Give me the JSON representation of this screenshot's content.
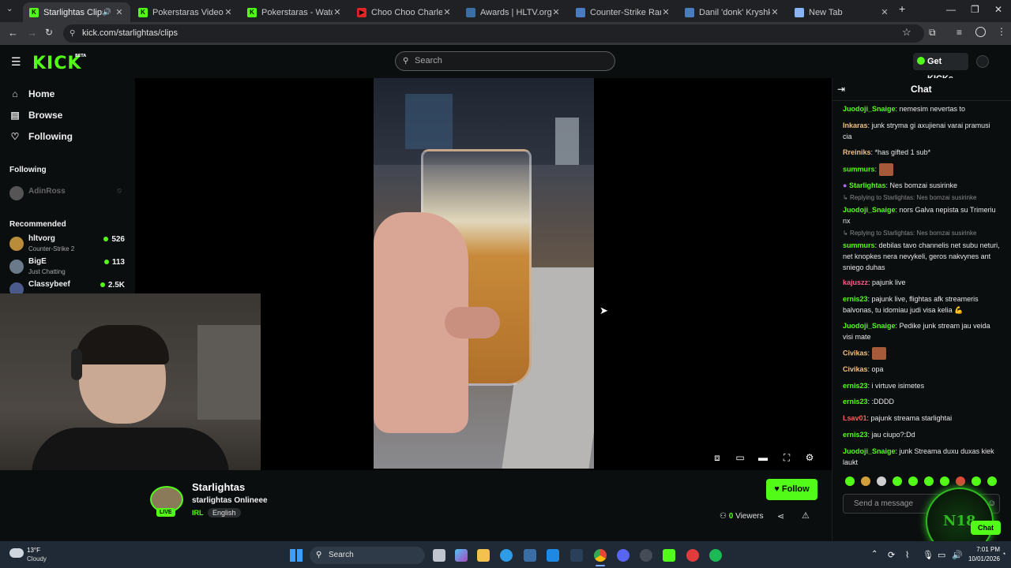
{
  "browser": {
    "tabs": [
      {
        "title": "Starlightas Clips - Wa",
        "favicon_color": "#53fc18",
        "favicon_text": "K",
        "active": true
      },
      {
        "title": "Pokerstaras Videos - Wat",
        "favicon_color": "#53fc18",
        "favicon_text": "K"
      },
      {
        "title": "Pokerstaras - Watch the V",
        "favicon_color": "#53fc18",
        "favicon_text": "K"
      },
      {
        "title": "Choo Choo Charles | KILL",
        "favicon_color": "#e02424",
        "favicon_text": "▶"
      },
      {
        "title": "Awards | HLTV.org",
        "favicon_color": "#3b6ea5",
        "favicon_text": ""
      },
      {
        "title": "Counter-Strike Ranking |",
        "favicon_color": "#4a7dbf",
        "favicon_text": ""
      },
      {
        "title": "Danil 'donk' Kryshkovets'",
        "favicon_color": "#4a7dbf",
        "favicon_text": ""
      },
      {
        "title": "New Tab",
        "favicon_color": "#8ab4f8",
        "favicon_text": ""
      }
    ],
    "url": "kick.com/starlightas/clips"
  },
  "header": {
    "logo": "KICK",
    "logo_badge": "BETA",
    "search_placeholder": "Search",
    "get_kicks": "Get KICKs"
  },
  "sidebar": {
    "nav": [
      {
        "label": "Home",
        "icon": "home-icon"
      },
      {
        "label": "Browse",
        "icon": "browse-icon"
      },
      {
        "label": "Following",
        "icon": "heart-icon"
      }
    ],
    "following_title": "Following",
    "following": [
      {
        "name": "AdinRoss"
      }
    ],
    "recommended_title": "Recommended",
    "recommended": [
      {
        "name": "hltvorg",
        "category": "Counter-Strike 2",
        "viewers": "526",
        "color": "#b98c3a"
      },
      {
        "name": "BigE",
        "category": "Just Chatting",
        "viewers": "113",
        "color": "#6a7a8a"
      },
      {
        "name": "Classybeef",
        "category": "",
        "viewers": "2.5K",
        "color": "#4a5a8a"
      }
    ]
  },
  "channel": {
    "name": "Starlightas",
    "title": "starlightas Onlineee",
    "category": "IRL",
    "language": "English",
    "live_badge": "LIVE",
    "follow_label": "Follow",
    "viewers_count": "0",
    "viewers_label": "Viewers"
  },
  "chat": {
    "title": "Chat",
    "messages": [
      {
        "user": "Juodoji_Snaige",
        "color": "#53fc18",
        "text": "nemesim nevertas to"
      },
      {
        "user": "Inkaras",
        "color": "#f0c080",
        "text": "junk stryma gi axujienai varai pramusi cia"
      },
      {
        "user": "Rreiniks",
        "color": "#f0c080",
        "text": "*has gifted 1 sub*"
      },
      {
        "user": "summurs",
        "color": "#53fc18",
        "text": ""
      },
      {
        "user": "Starlightas",
        "color": "#53fc18",
        "text": "Nes bomzai susirinke"
      },
      {
        "user": "Juodoji_Snaige",
        "color": "#53fc18",
        "text": "nors Galva nepista su Trimeriu nx",
        "reply": "Replying to Starlightas: Nes bomzai susirinke"
      },
      {
        "user": "summurs",
        "color": "#53fc18",
        "text": "debilas tavo channelis net subu neturi, net knopkes nera nevykeli, geros nakvynes ant sniego duhas",
        "reply": "Replying to Starlightas: Nes bomzai susirinke"
      },
      {
        "user": "kajuszz",
        "color": "#ff5a8a",
        "text": "pajunk live"
      },
      {
        "user": "ernis23",
        "color": "#53fc18",
        "text": "pajunk live, flightas afk streameris balvonas, tu idomiau judi visa kelia 💪"
      },
      {
        "user": "Juodoji_Snaige",
        "color": "#53fc18",
        "text": "Pedike junk stream jau veida visi mate"
      },
      {
        "user": "Civikas",
        "color": "#f0c080",
        "text": ""
      },
      {
        "user": "Civikas",
        "color": "#f0c080",
        "text": "opa"
      },
      {
        "user": "ernis23",
        "color": "#53fc18",
        "text": "i virtuve isimetes"
      },
      {
        "user": "ernis23",
        "color": "#53fc18",
        "text": ":DDDD"
      },
      {
        "user": "Lsav01",
        "color": "#ff5a5a",
        "text": "pajunk streama starlightai"
      },
      {
        "user": "ernis23",
        "color": "#53fc18",
        "text": "jau ciupo?:Dd"
      },
      {
        "user": "Juodoji_Snaige",
        "color": "#53fc18",
        "text": "junk Streama duxu duxas kiek laukt"
      }
    ],
    "send_placeholder": "Send a message",
    "overlay_button": "Chat",
    "overlay_text": "N18"
  },
  "taskbar": {
    "weather_temp": "13°F",
    "weather_desc": "Cloudy",
    "search": "Search",
    "time": "7:01 PM",
    "date": "10/01/2026"
  }
}
